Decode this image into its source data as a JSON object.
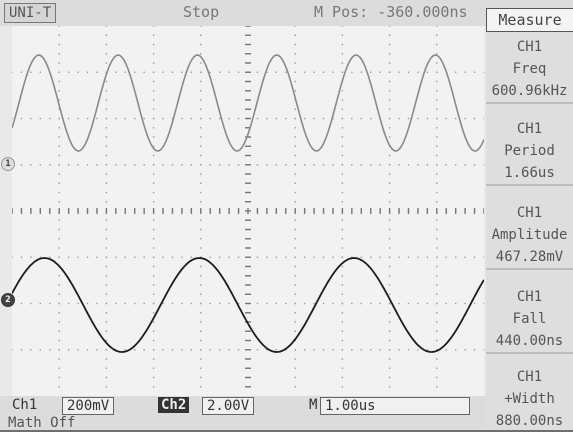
{
  "top": {
    "brand": "UNI-T",
    "status": "Stop",
    "m_pos": "M Pos: -360.000ns"
  },
  "side": {
    "title": "Measure",
    "items": [
      {
        "channel": "CH1",
        "name": "Freq",
        "value": "600.96kHz"
      },
      {
        "channel": "CH1",
        "name": "Period",
        "value": "1.66us"
      },
      {
        "channel": "CH1",
        "name": "Amplitude",
        "value": "467.28mV"
      },
      {
        "channel": "CH1",
        "name": "Fall",
        "value": "440.00ns"
      },
      {
        "channel": "CH1",
        "name": "+Width",
        "value": "880.00ns"
      }
    ]
  },
  "bottom": {
    "ch1_label": "Ch1",
    "ch1_scale": "200mV",
    "ch2_label": "Ch2",
    "ch2_scale": "2.00V",
    "time_label": "M",
    "time_scale": "1.00us",
    "math": "Math Off"
  },
  "markers": {
    "ch1": "1",
    "ch2": "2"
  },
  "colors": {
    "ch1_trace": "#8a8a8a",
    "ch2_trace": "#1c1c1c",
    "grid_dots": "#9a9a9a"
  },
  "traces": {
    "ch1_cycles_on_screen": 5.95,
    "ch2_cycles_on_screen": 3.05
  }
}
